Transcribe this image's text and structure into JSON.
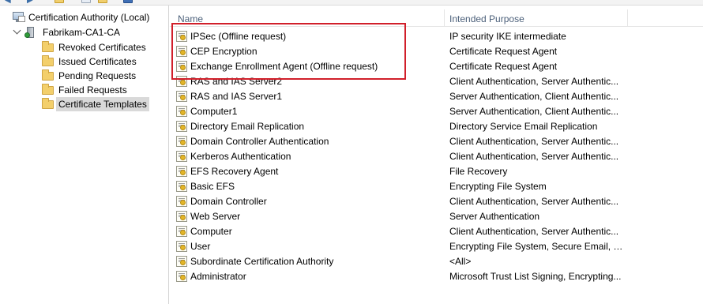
{
  "colors": {
    "highlight": "#d11f2a",
    "header_text": "#4c607a",
    "selection": "#d9d9d9"
  },
  "tree": {
    "root_label": "Certification Authority (Local)",
    "ca_label": "Fabrikam-CA1-CA",
    "children": [
      {
        "label": "Revoked Certificates",
        "icon": "folder-icon",
        "selected": false
      },
      {
        "label": "Issued Certificates",
        "icon": "folder-icon",
        "selected": false
      },
      {
        "label": "Pending Requests",
        "icon": "folder-icon",
        "selected": false
      },
      {
        "label": "Failed Requests",
        "icon": "folder-icon",
        "selected": false
      },
      {
        "label": "Certificate Templates",
        "icon": "folder-icon",
        "selected": true
      }
    ]
  },
  "list": {
    "columns": {
      "name": "Name",
      "purpose": "Intended Purpose"
    },
    "rows": [
      {
        "name": "IPSec (Offline request)",
        "purpose": "IP security IKE intermediate",
        "highlighted": true
      },
      {
        "name": "CEP Encryption",
        "purpose": "Certificate Request Agent",
        "highlighted": true
      },
      {
        "name": "Exchange Enrollment Agent (Offline request)",
        "purpose": "Certificate Request Agent",
        "highlighted": true
      },
      {
        "name": "RAS and IAS Server2",
        "purpose": "Client Authentication, Server Authentic...",
        "highlighted": false
      },
      {
        "name": "RAS and IAS Server1",
        "purpose": "Server Authentication, Client Authentic...",
        "highlighted": false
      },
      {
        "name": "Computer1",
        "purpose": "Server Authentication, Client Authentic...",
        "highlighted": false
      },
      {
        "name": "Directory Email Replication",
        "purpose": "Directory Service Email Replication",
        "highlighted": false
      },
      {
        "name": "Domain Controller Authentication",
        "purpose": "Client Authentication, Server Authentic...",
        "highlighted": false
      },
      {
        "name": "Kerberos Authentication",
        "purpose": "Client Authentication, Server Authentic...",
        "highlighted": false
      },
      {
        "name": "EFS Recovery Agent",
        "purpose": "File Recovery",
        "highlighted": false
      },
      {
        "name": "Basic EFS",
        "purpose": "Encrypting File System",
        "highlighted": false
      },
      {
        "name": "Domain Controller",
        "purpose": "Client Authentication, Server Authentic...",
        "highlighted": false
      },
      {
        "name": "Web Server",
        "purpose": "Server Authentication",
        "highlighted": false
      },
      {
        "name": "Computer",
        "purpose": "Client Authentication, Server Authentic...",
        "highlighted": false
      },
      {
        "name": "User",
        "purpose": "Encrypting File System, Secure Email, Cl...",
        "highlighted": false
      },
      {
        "name": "Subordinate Certification Authority",
        "purpose": "<All>",
        "highlighted": false
      },
      {
        "name": "Administrator",
        "purpose": "Microsoft Trust List Signing, Encrypting...",
        "highlighted": false
      }
    ]
  }
}
